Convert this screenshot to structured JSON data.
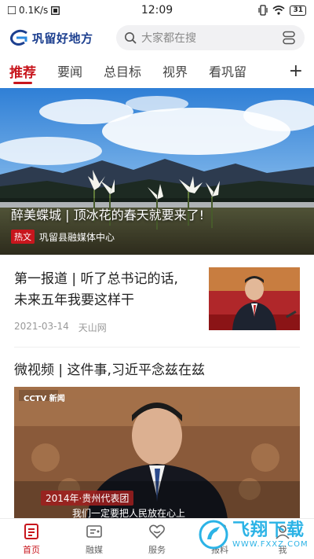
{
  "status_bar": {
    "speed": "0.1K/s",
    "time": "12:09",
    "battery": "31"
  },
  "header": {
    "app_name": "巩留好地方",
    "search_placeholder": "大家都在搜"
  },
  "tabs": [
    {
      "label": "推荐",
      "active": true
    },
    {
      "label": "要闻",
      "active": false
    },
    {
      "label": "总目标",
      "active": false
    },
    {
      "label": "视界",
      "active": false
    },
    {
      "label": "看巩留",
      "active": false
    }
  ],
  "tabs_add": "+",
  "hero": {
    "title": "醉美蝶城 | 顶冰花的春天就要来了!",
    "badge": "热文",
    "source": "巩留县融媒体中心"
  },
  "articles": [
    {
      "title": "第一报道 | 听了总书记的话,未来五年我要这样干",
      "date": "2021-03-14",
      "source": "天山网"
    },
    {
      "title": "微视频 | 这件事,习近平念兹在兹",
      "video_caption": "2014年·贵州代表团",
      "video_subtitle": "我们一定要把人民放在心上",
      "channel_logo": "CCTV 新闻"
    }
  ],
  "bottom_nav": [
    {
      "label": "首页",
      "icon": "home-doc-icon",
      "active": true
    },
    {
      "label": "融媒",
      "icon": "media-icon",
      "active": false
    },
    {
      "label": "服务",
      "icon": "heart-service-icon",
      "active": false
    },
    {
      "label": "报料",
      "icon": "report-icon",
      "active": false
    },
    {
      "label": "我",
      "icon": "user-icon",
      "active": false
    }
  ],
  "watermark": {
    "main": "飞翔下载",
    "sub": "WWW.FXXZ.COM"
  },
  "colors": {
    "accent": "#c8161d",
    "logo_blue": "#1c3f8f",
    "watermark_blue": "#2bb3e6"
  }
}
